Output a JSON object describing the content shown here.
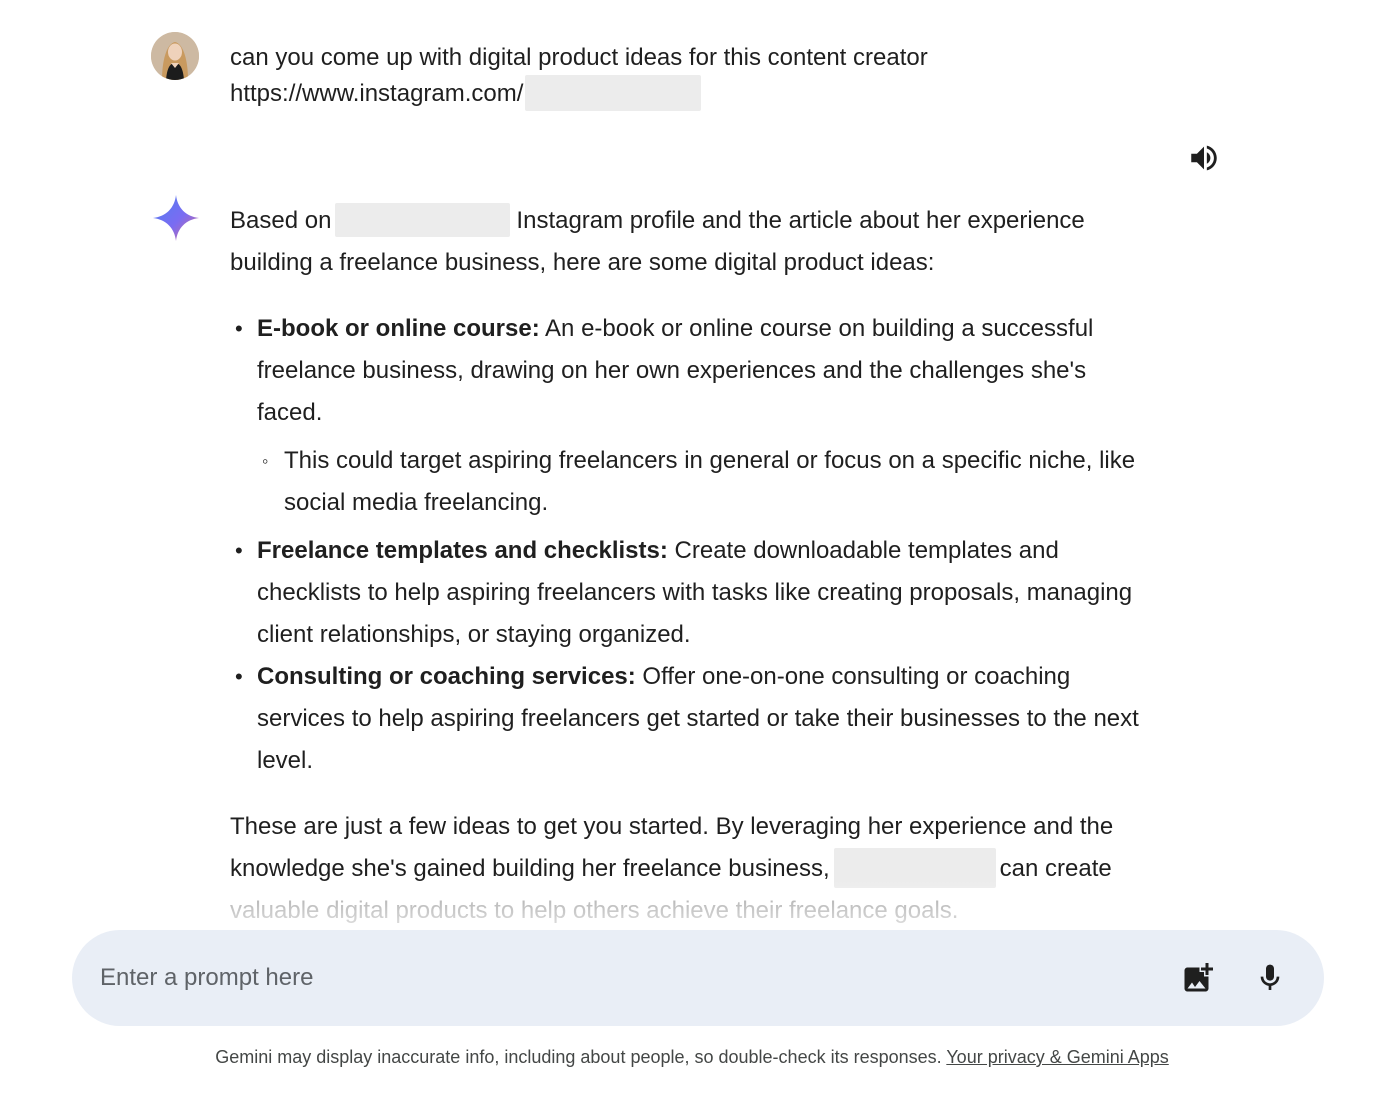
{
  "user_prompt": {
    "line1": "can you come up with digital product ideas for this content creator",
    "line2": "https://www.instagram.com/"
  },
  "response": {
    "intro_before_redaction": "Based on",
    "intro_after_redaction": "Instagram profile and the article about her experience building a freelance business, here are some digital product ideas:",
    "items": [
      {
        "title": "E-book or online course:",
        "text": "An e-book or online course on building a successful freelance business, drawing on her own experiences and the challenges she's faced.",
        "sub": "This could target aspiring freelancers in general or focus on a specific niche, like social media freelancing."
      },
      {
        "title": "Freelance templates and checklists:",
        "text": "Create downloadable templates and checklists to help aspiring freelancers with tasks like creating proposals, managing client relationships, or staying organized."
      },
      {
        "title": "Consulting or coaching services:",
        "text": "Offer one-on-one consulting or coaching services to help aspiring freelancers get started or take their businesses to the next level."
      }
    ],
    "closing_before_redaction": "These are just a few ideas to get you started. By leveraging her experience and the knowledge she's gained building her freelance business,",
    "closing_after_redaction": "can create",
    "closing_faded": "valuable digital products to help others achieve their freelance goals."
  },
  "prompt_bar": {
    "placeholder": "Enter a prompt here"
  },
  "disclaimer": {
    "text": "Gemini may display inaccurate info, including about people, so double-check its responses.",
    "link": "Your privacy & Gemini Apps"
  },
  "icons": {
    "speaker": "speaker-icon",
    "gemini": "gemini-sparkle-icon",
    "image_upload": "add-image-icon",
    "microphone": "microphone-icon"
  },
  "colors": {
    "prompt_bar_bg": "#e9eef6",
    "redaction": "#ececec",
    "text": "#1f1f1f",
    "muted": "#444746"
  }
}
